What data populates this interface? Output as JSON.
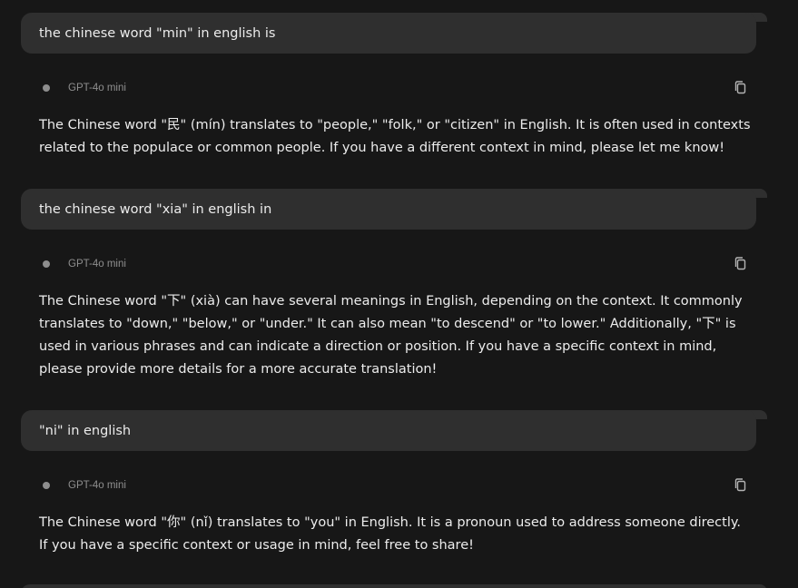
{
  "conversation": [
    {
      "user": "the chinese word \"min\" in english is",
      "model": "GPT-4o mini",
      "copy_icon": "copy-icon",
      "answer": "The Chinese word \"民\" (mín) translates to \"people,\" \"folk,\" or \"citizen\" in English. It is often used in contexts related to the populace or common people. If you have a different context in mind, please let me know!"
    },
    {
      "user": "the chinese word \"xia\" in english in",
      "model": "GPT-4o mini",
      "copy_icon": "copy-icon",
      "answer": "The Chinese word \"下\" (xià) can have several meanings in English, depending on the context. It commonly translates to \"down,\" \"below,\" or \"under.\" It can also mean \"to descend\" or \"to lower.\" Additionally, \"下\" is used in various phrases and can indicate a direction or position. If you have a specific context in mind, please provide more details for a more accurate translation!"
    },
    {
      "user": "\"ni\" in english",
      "model": "GPT-4o mini",
      "copy_icon": "copy-icon",
      "answer": "The Chinese word \"你\" (nǐ) translates to \"you\" in English. It is a pronoun used to address someone directly. If you have a specific context or usage in mind, feel free to share!"
    }
  ],
  "colors": {
    "background": "#171717",
    "user_bubble": "#2f2f2f",
    "text": "#ececec",
    "muted": "#8e8e8e"
  }
}
